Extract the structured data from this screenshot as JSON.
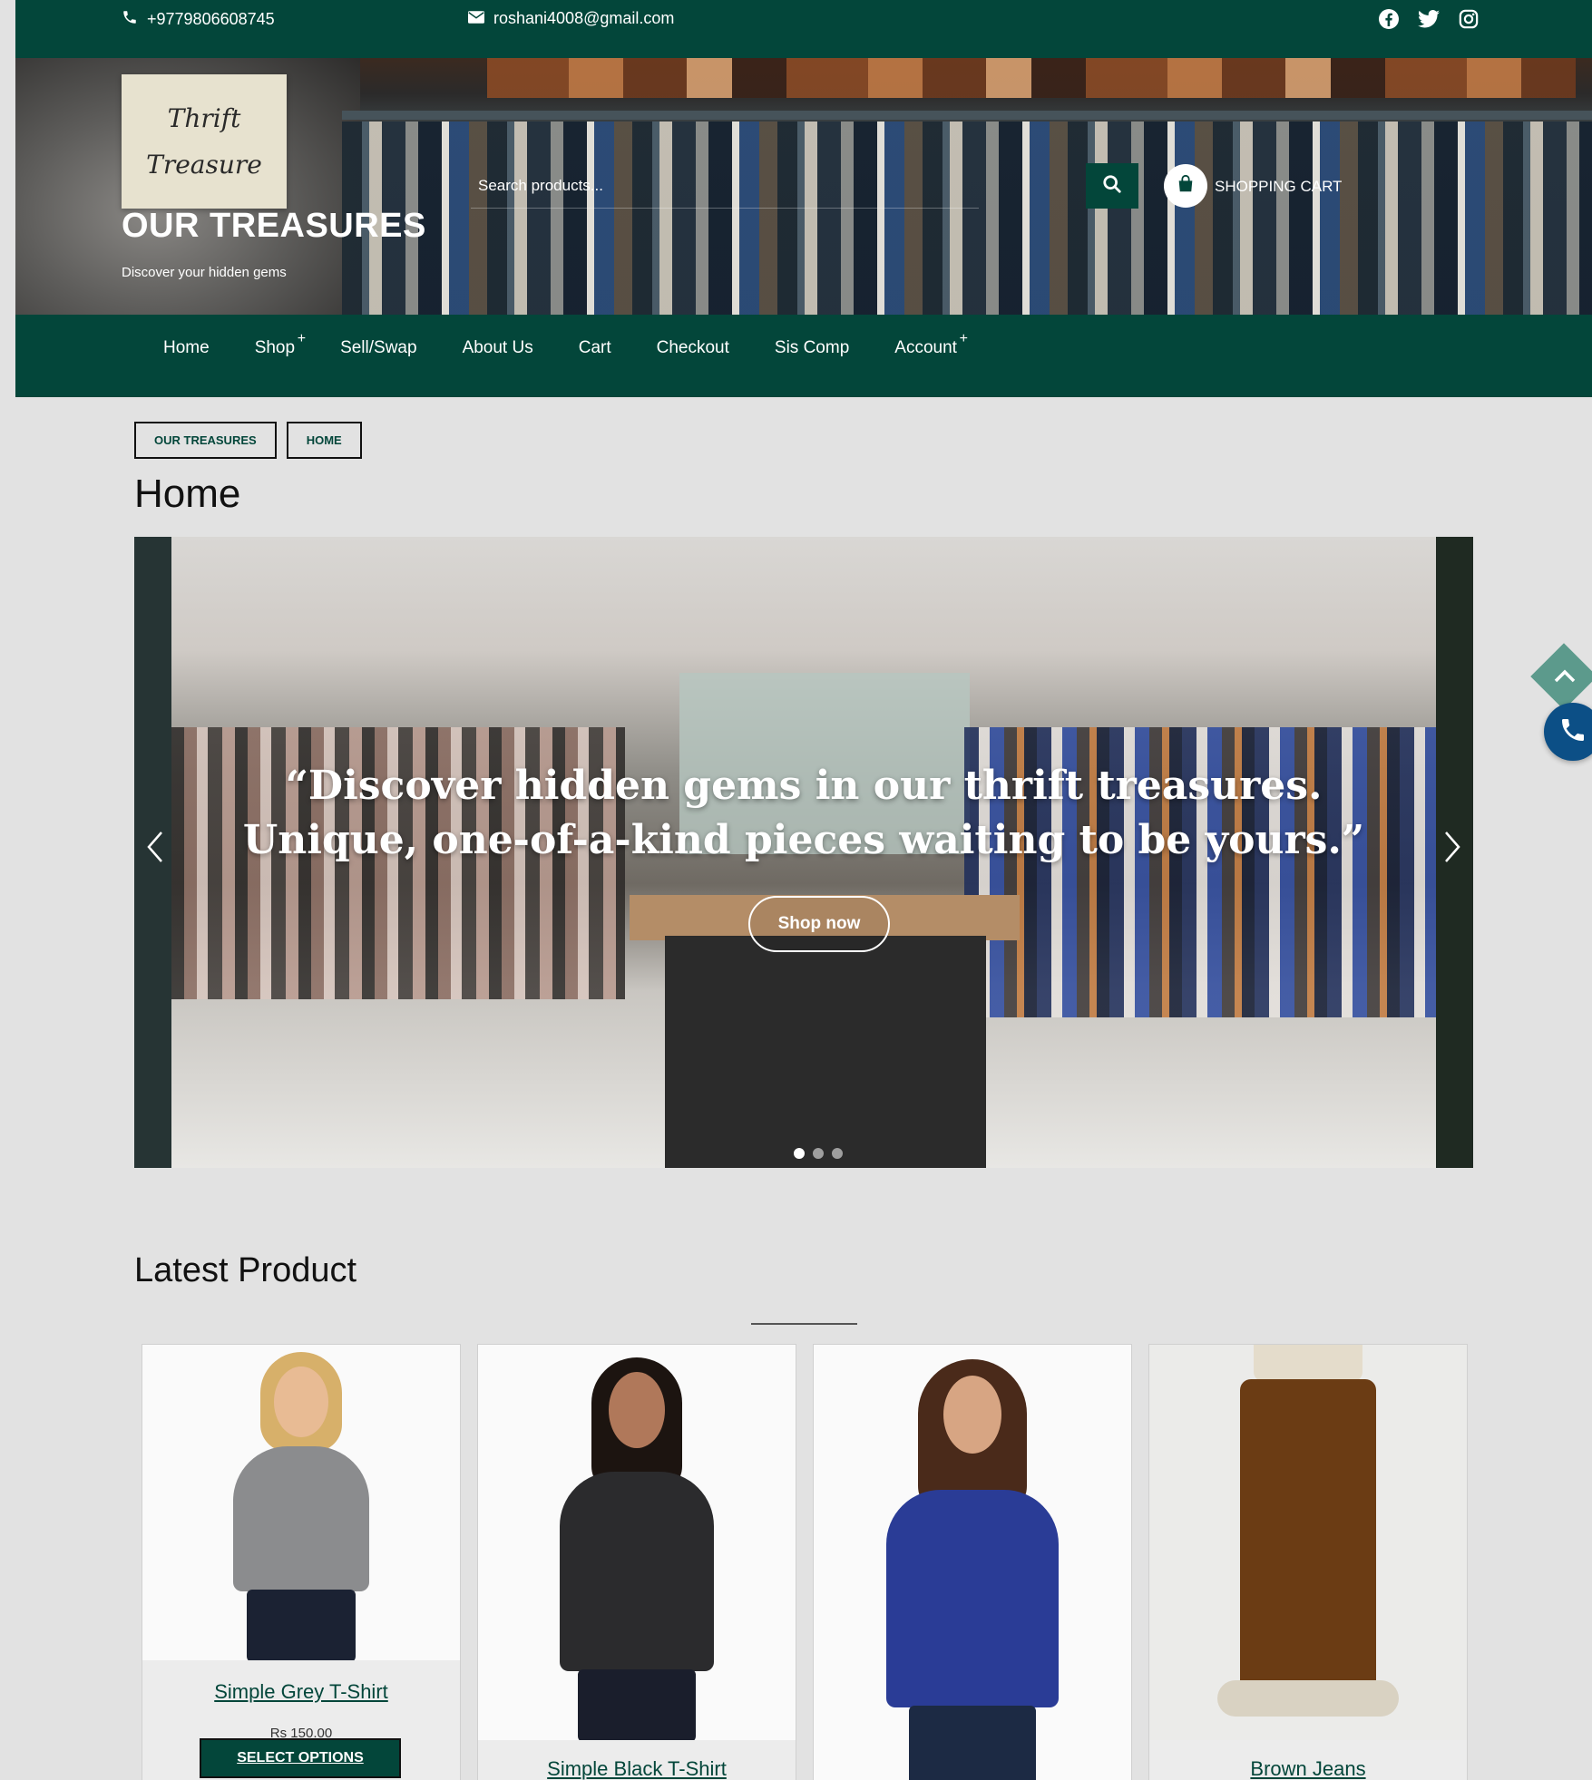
{
  "topbar": {
    "phone": "+9779806608745",
    "email": "roshani4008@gmail.com",
    "socials": [
      "facebook-icon",
      "twitter-icon",
      "instagram-icon"
    ]
  },
  "header": {
    "logo_line1": "Thrift",
    "logo_line2": "Treasure",
    "site_title": "OUR TREASURES",
    "tagline": "Discover your hidden gems",
    "search_placeholder": "Search products...",
    "cart_label": "SHOPPING CART"
  },
  "nav": {
    "items": [
      {
        "label": "Home",
        "has_submenu": false
      },
      {
        "label": "Shop",
        "has_submenu": true
      },
      {
        "label": "Sell/Swap",
        "has_submenu": false
      },
      {
        "label": "About Us",
        "has_submenu": false
      },
      {
        "label": "Cart",
        "has_submenu": false
      },
      {
        "label": "Checkout",
        "has_submenu": false
      },
      {
        "label": "Sis Comp",
        "has_submenu": false
      },
      {
        "label": "Account",
        "has_submenu": true
      }
    ],
    "submenu_indicator": "+"
  },
  "breadcrumb": [
    "OUR TREASURES",
    "HOME"
  ],
  "page_title": "Home",
  "slider": {
    "quote": "“Discover hidden gems in our thrift treasures. Unique, one-of-a-kind pieces waiting to be yours.”",
    "button": "Shop now",
    "slide_count": 3,
    "active_slide": 1
  },
  "latest": {
    "title": "Latest Product",
    "products": [
      {
        "name": "Simple Grey T-Shirt",
        "price": "Rs 150.00",
        "button": "SELECT OPTIONS"
      },
      {
        "name": "Simple Black T-Shirt"
      },
      {
        "name": ""
      },
      {
        "name": "Brown Jeans"
      }
    ]
  },
  "colors": {
    "brand": "#03463a",
    "background": "#e2e2e2",
    "call_button": "#0c4f86",
    "scroll_top": "#5c9a8c"
  }
}
